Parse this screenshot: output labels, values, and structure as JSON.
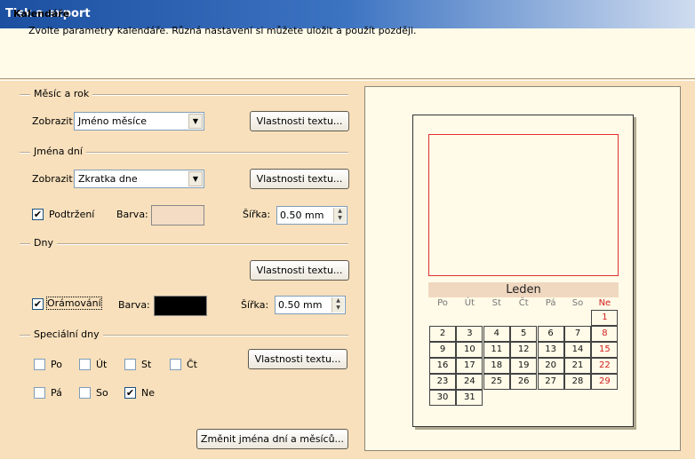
{
  "window": {
    "title": "Tisk a export"
  },
  "header": {
    "title": "Kalendáře",
    "description": "Zvolte parametry kalendáře. Různá nastavení si můžete uložit a použít později."
  },
  "month_year": {
    "group_label": "Měsíc a rok",
    "show_label": "Zobrazit:",
    "show_value": "Jméno měsíce",
    "text_props_label": "Vlastnosti textu..."
  },
  "day_names": {
    "group_label": "Jména dní",
    "show_label": "Zobrazit:",
    "show_value": "Zkratka dne",
    "text_props_label": "Vlastnosti textu...",
    "underline_label": "Podtržení",
    "underline_checked": true,
    "color_label": "Barva:",
    "color_value": "#f4dcc4",
    "width_label": "Šířka:",
    "width_value": "0.50 mm"
  },
  "days": {
    "group_label": "Dny",
    "text_props_label": "Vlastnosti textu...",
    "border_label": "Orámování",
    "border_checked": true,
    "color_label": "Barva:",
    "color_value": "#000000",
    "width_label": "Šířka:",
    "width_value": "0.50 mm"
  },
  "special_days": {
    "group_label": "Speciální dny",
    "text_props_label": "Vlastnosti textu...",
    "items": [
      {
        "label": "Po",
        "checked": false
      },
      {
        "label": "Út",
        "checked": false
      },
      {
        "label": "St",
        "checked": false
      },
      {
        "label": "Čt",
        "checked": false
      },
      {
        "label": "Pá",
        "checked": false
      },
      {
        "label": "So",
        "checked": false
      },
      {
        "label": "Ne",
        "checked": true
      }
    ]
  },
  "change_names_button": "Změnit jména dní a měsíců...",
  "preview": {
    "month": "Leden",
    "day_headers": [
      "Po",
      "Út",
      "St",
      "Čt",
      "Pá",
      "So",
      "Ne"
    ],
    "weeks": [
      [
        "",
        "",
        "",
        "",
        "",
        "",
        "1"
      ],
      [
        "2",
        "3",
        "4",
        "5",
        "6",
        "7",
        "8"
      ],
      [
        "9",
        "10",
        "11",
        "12",
        "13",
        "14",
        "15"
      ],
      [
        "16",
        "17",
        "18",
        "19",
        "20",
        "21",
        "22"
      ],
      [
        "23",
        "24",
        "25",
        "26",
        "27",
        "28",
        "29"
      ],
      [
        "30",
        "31",
        "",
        "",
        "",
        "",
        ""
      ]
    ],
    "highlight_color": "#d02020"
  }
}
